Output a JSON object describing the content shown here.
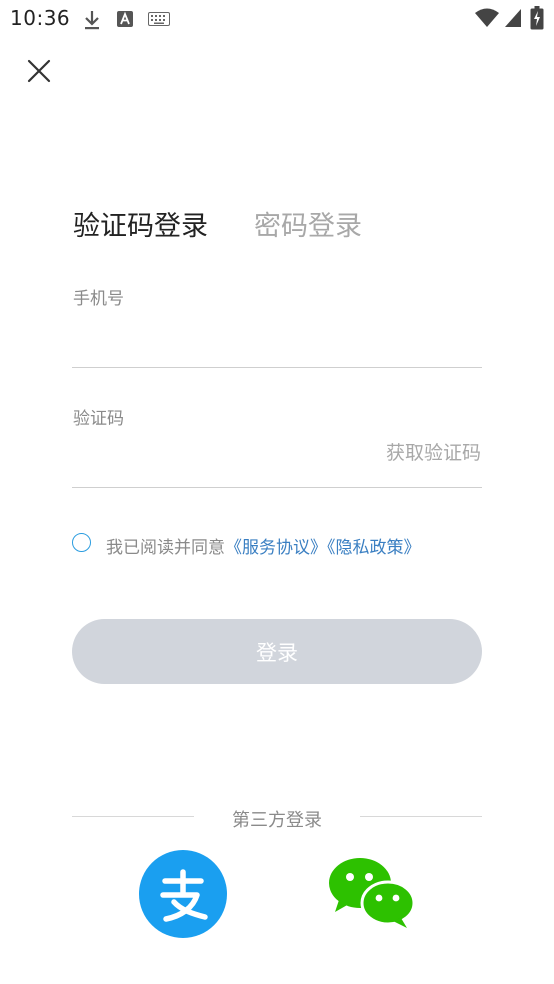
{
  "status_bar": {
    "time": "10:36",
    "icons": [
      "download-icon",
      "text-a-icon",
      "keyboard-icon",
      "wifi-icon",
      "signal-icon",
      "battery-charging-icon"
    ]
  },
  "header": {
    "close_icon": "close-icon"
  },
  "tabs": [
    {
      "label": "验证码登录",
      "active": true
    },
    {
      "label": "密码登录",
      "active": false
    }
  ],
  "form": {
    "phone": {
      "label": "手机号",
      "value": "",
      "placeholder": ""
    },
    "code": {
      "label": "验证码",
      "value": "",
      "placeholder": "",
      "get_code_label": "获取验证码"
    }
  },
  "agreement": {
    "checked": false,
    "prefix": "我已阅读并同意",
    "service_link": "《服务协议》",
    "privacy_link": "《隐私政策》"
  },
  "login_button": {
    "label": "登录"
  },
  "third_party": {
    "title": "第三方登录",
    "providers": [
      "alipay-icon",
      "wechat-icon"
    ]
  },
  "colors": {
    "accent": "#2c9de0",
    "link": "#3a7fc2",
    "button_disabled": "#d1d5dc",
    "alipay": "#1a9ff0",
    "wechat": "#2dc100"
  }
}
